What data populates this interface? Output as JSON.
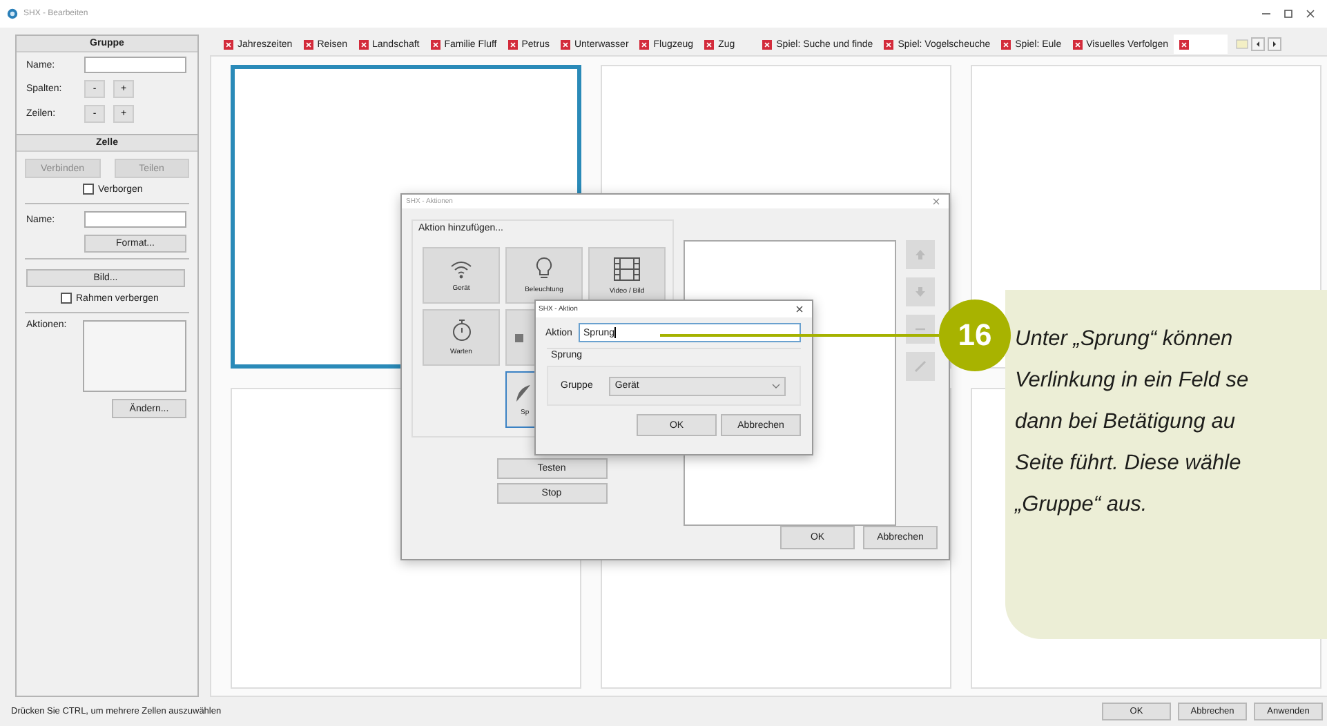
{
  "window": {
    "title": "SHX - Bearbeiten"
  },
  "sidebar": {
    "group": {
      "heading": "Gruppe",
      "fields": [
        {
          "kind": "input",
          "label": "Name:"
        },
        {
          "kind": "stepper",
          "label": "Spalten:",
          "buttons": [
            "-",
            "+"
          ]
        },
        {
          "kind": "stepper",
          "label": "Zeilen:",
          "buttons": [
            "-",
            "+"
          ]
        }
      ]
    },
    "cell": {
      "heading": "Zelle",
      "buttons": [
        {
          "label": "Verbinden",
          "disabled": true
        },
        {
          "label": "Teilen",
          "disabled": true
        }
      ],
      "hidden_checkbox": {
        "label": "Verborgen",
        "checked": false
      },
      "name_label": "Name:",
      "format_button": "Format...",
      "image_button": "Bild...",
      "frame_checkbox": {
        "label": "Rahmen verbergen",
        "checked": false
      },
      "actions_label": "Aktionen:",
      "change_button": "Ändern..."
    }
  },
  "tabs": [
    {
      "label": "Jahreszeiten",
      "selected": false
    },
    {
      "label": "Reisen",
      "selected": false
    },
    {
      "label": "Landschaft",
      "selected": false
    },
    {
      "label": "Familie Fluff",
      "selected": false
    },
    {
      "label": "Petrus",
      "selected": false
    },
    {
      "label": "Unterwasser",
      "selected": false
    },
    {
      "label": "Flugzeug",
      "selected": false
    },
    {
      "label": "Zug",
      "selected": false
    },
    {
      "label": "Spiel: Suche und finde",
      "selected": false
    },
    {
      "label": "Spiel: Vogelscheuche",
      "selected": false
    },
    {
      "label": "Spiel: Eule",
      "selected": false
    },
    {
      "label": "Visuelles Verfolgen",
      "selected": false
    },
    {
      "selected": true
    }
  ],
  "grid": {
    "cells": [
      {
        "selected": true
      },
      {
        "selected": false
      },
      {
        "selected": false
      },
      {
        "selected": false
      },
      {
        "selected": false
      },
      {
        "selected": false
      }
    ]
  },
  "actions_dialog": {
    "title": "SHX - Aktionen",
    "group_label": "Aktion hinzufügen...",
    "tiles": [
      {
        "kind": "wifi",
        "label": "Gerät",
        "selected": false
      },
      {
        "kind": "bulb",
        "label": "Beleuchtung",
        "selected": false
      },
      {
        "kind": "film",
        "label": "Video / Bild",
        "selected": false
      },
      {
        "kind": "timer",
        "label": "Warten",
        "selected": false
      },
      {
        "kind": "square",
        "selected": false
      },
      {
        "kind": "blank"
      },
      {
        "kind": "blank"
      },
      {
        "kind": "leaf",
        "label": "Sp",
        "selected": true
      }
    ],
    "test_button": "Testen",
    "stop_button": "Stop",
    "ok_button": "OK",
    "cancel_button": "Abbrechen"
  },
  "action_dialog": {
    "title": "SHX - Aktion",
    "action_label": "Aktion",
    "action_value": "Sprung",
    "section": "Sprung",
    "group_label": "Gruppe",
    "group_value": "Gerät",
    "ok_button": "OK",
    "cancel_button": "Abbrechen"
  },
  "callout": {
    "number": "16",
    "lines": [
      "Unter „Sprung“ können",
      "Verlinkung in ein Feld se",
      "dann bei Betätigung au",
      "Seite führt. Diese wähle",
      "„Gruppe“ aus."
    ]
  },
  "status_bar": {
    "hint": "Drücken Sie CTRL, um mehrere Zellen auszuwählen",
    "buttons": [
      "OK",
      "Abbrechen",
      "Anwenden"
    ]
  }
}
